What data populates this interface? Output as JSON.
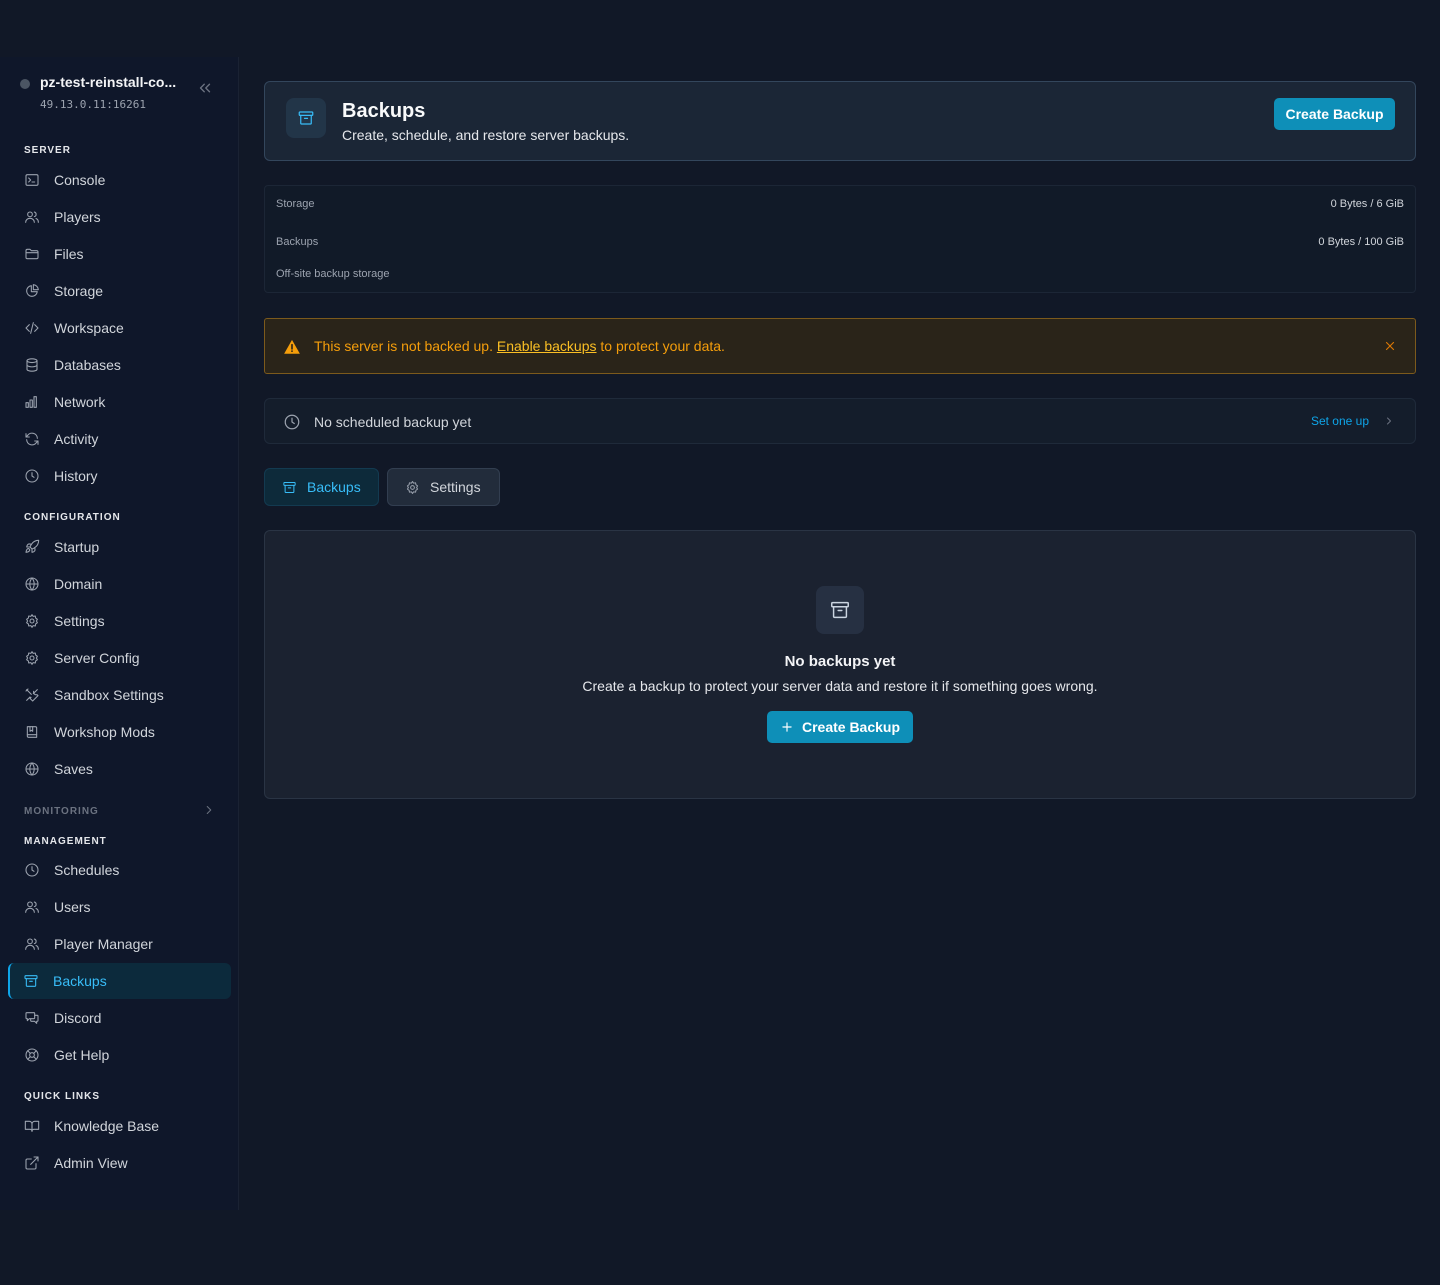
{
  "server": {
    "name": "pz-test-reinstall-co...",
    "address": "49.13.0.11:16261"
  },
  "sidebar": {
    "sections": {
      "server": "SERVER",
      "configuration": "CONFIGURATION",
      "monitoring": "MONITORING",
      "management": "MANAGEMENT",
      "quick_links": "QUICK LINKS"
    },
    "server_items": [
      {
        "label": "Console",
        "icon": "terminal-icon"
      },
      {
        "label": "Players",
        "icon": "users-icon"
      },
      {
        "label": "Files",
        "icon": "folder-icon"
      },
      {
        "label": "Storage",
        "icon": "pie-chart-icon"
      },
      {
        "label": "Workspace",
        "icon": "code-icon"
      },
      {
        "label": "Databases",
        "icon": "database-icon"
      },
      {
        "label": "Network",
        "icon": "bar-chart-icon"
      },
      {
        "label": "Activity",
        "icon": "refresh-icon"
      },
      {
        "label": "History",
        "icon": "clock-icon"
      }
    ],
    "configuration_items": [
      {
        "label": "Startup",
        "icon": "rocket-icon"
      },
      {
        "label": "Domain",
        "icon": "globe-icon"
      },
      {
        "label": "Settings",
        "icon": "gear-icon"
      },
      {
        "label": "Server Config",
        "icon": "gear-icon"
      },
      {
        "label": "Sandbox Settings",
        "icon": "tools-icon"
      },
      {
        "label": "Workshop Mods",
        "icon": "book-icon"
      },
      {
        "label": "Saves",
        "icon": "globe-icon"
      }
    ],
    "management_items": [
      {
        "label": "Schedules",
        "icon": "clock-icon"
      },
      {
        "label": "Users",
        "icon": "users-icon"
      },
      {
        "label": "Player Manager",
        "icon": "users-icon"
      },
      {
        "label": "Backups",
        "icon": "archive-icon",
        "active": true
      },
      {
        "label": "Discord",
        "icon": "chat-icon"
      },
      {
        "label": "Get Help",
        "icon": "lifebuoy-icon"
      }
    ],
    "quick_links": [
      {
        "label": "Knowledge Base",
        "icon": "open-book-icon"
      },
      {
        "label": "Admin View",
        "icon": "external-link-icon"
      }
    ]
  },
  "header": {
    "title": "Backups",
    "subtitle": "Create, schedule, and restore server backups.",
    "create_button": "Create Backup"
  },
  "storage": {
    "storage_label": "Storage",
    "storage_value": "0 Bytes / 6 GiB",
    "backups_label": "Backups",
    "backups_value": "0 Bytes / 100 GiB",
    "offsite_label": "Off-site backup storage"
  },
  "alert": {
    "text_before": "This server is not backed up. ",
    "link": "Enable backups",
    "text_after": " to protect your data."
  },
  "schedule": {
    "text": "No scheduled backup yet",
    "link": "Set one up"
  },
  "tabs": {
    "backups": "Backups",
    "settings": "Settings"
  },
  "empty": {
    "title": "No backups yet",
    "subtitle": "Create a backup to protect your server data and restore it if something goes wrong.",
    "button": "Create Backup"
  },
  "colors": {
    "accent": "#0e8fb8",
    "warning": "#f59e0b",
    "background": "#111827"
  }
}
